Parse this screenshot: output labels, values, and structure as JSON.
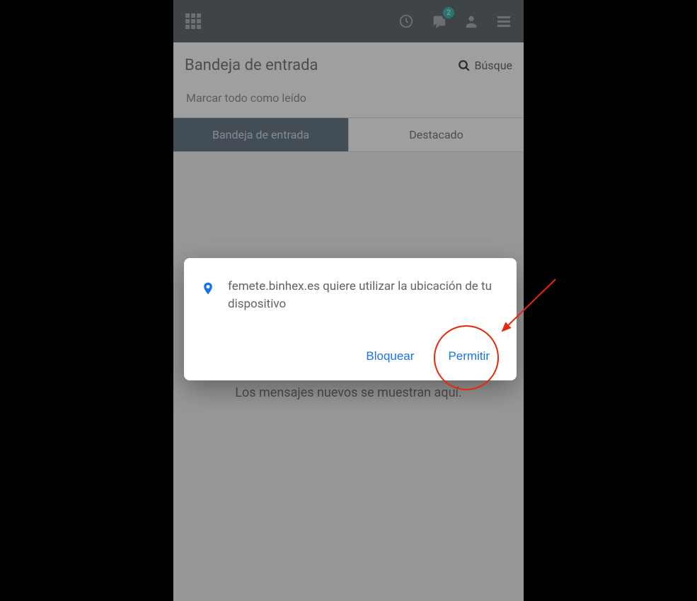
{
  "header": {
    "notification_count": "2"
  },
  "page": {
    "title": "Bandeja de entrada",
    "search_label": "Búsque",
    "mark_all_read": "Marcar todo como leído"
  },
  "tabs": {
    "inbox": "Bandeja de entrada",
    "featured": "Destacado"
  },
  "empty_state": {
    "message": "Los mensajes nuevos se muestran aquí."
  },
  "dialog": {
    "message": "femete.binhex.es quiere utilizar la ubicación de tu dispositivo",
    "block_label": "Bloquear",
    "allow_label": "Permitir"
  }
}
